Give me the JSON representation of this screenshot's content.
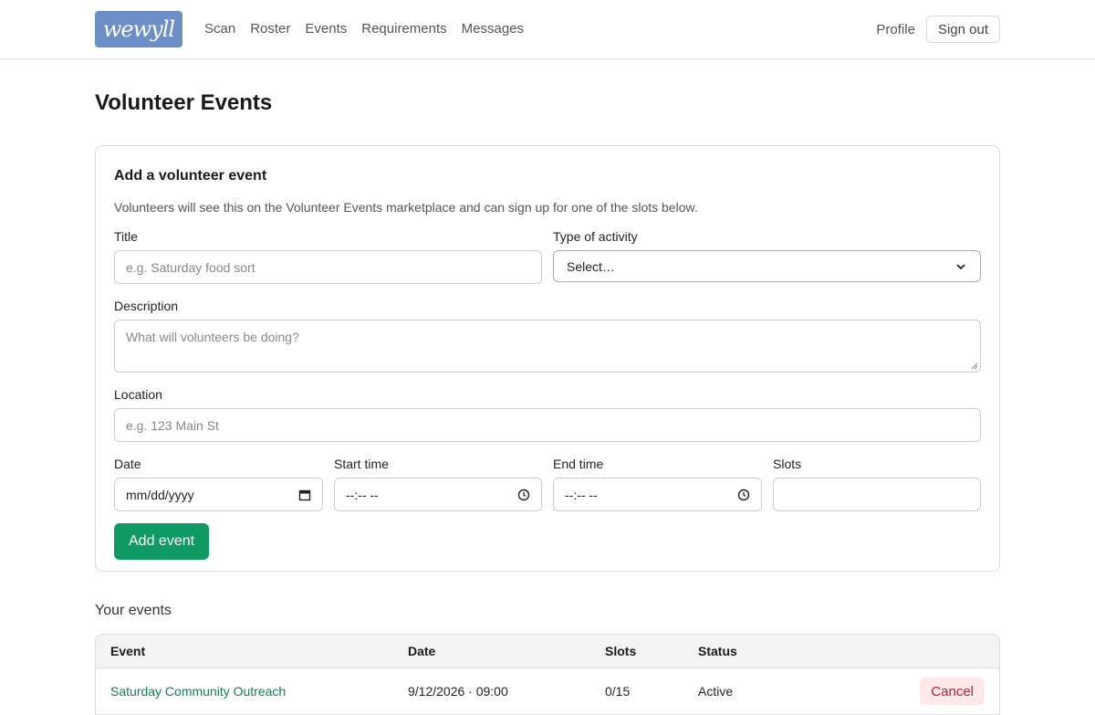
{
  "brand": {
    "logo_text": "wewyll",
    "logo_color": "#6b8fc6"
  },
  "nav": {
    "items": [
      "Scan",
      "Roster",
      "Events",
      "Requirements",
      "Messages"
    ],
    "profile": "Profile",
    "sign_out": "Sign out"
  },
  "page": {
    "title": "Volunteer Events"
  },
  "form": {
    "heading": "Add a volunteer event",
    "help": "Volunteers will see this on the Volunteer Events marketplace and can sign up for one of the slots below.",
    "title_label": "Title",
    "title_placeholder": "e.g. Saturday food sort",
    "activity_label": "Type of activity",
    "activity_value": "Select…",
    "description_label": "Description",
    "description_placeholder": "What will volunteers be doing?",
    "location_label": "Location",
    "location_placeholder": "e.g. 123 Main St",
    "date_label": "Date",
    "date_value": "mm/dd/yyyy",
    "start_label": "Start time",
    "start_value": "--:-- --",
    "end_label": "End time",
    "end_value": "--:-- --",
    "slots_label": "Slots",
    "slots_value": "",
    "submit_label": "Add event",
    "accent_color": "#0f9a63"
  },
  "events": {
    "heading": "Your events",
    "columns": [
      "Event",
      "Date",
      "Slots",
      "Status"
    ],
    "rows": [
      {
        "event": "Saturday Community Outreach",
        "date": "9/12/2026 · 09:00",
        "slots": "0/15",
        "status": "Active",
        "action": "Cancel"
      }
    ]
  }
}
